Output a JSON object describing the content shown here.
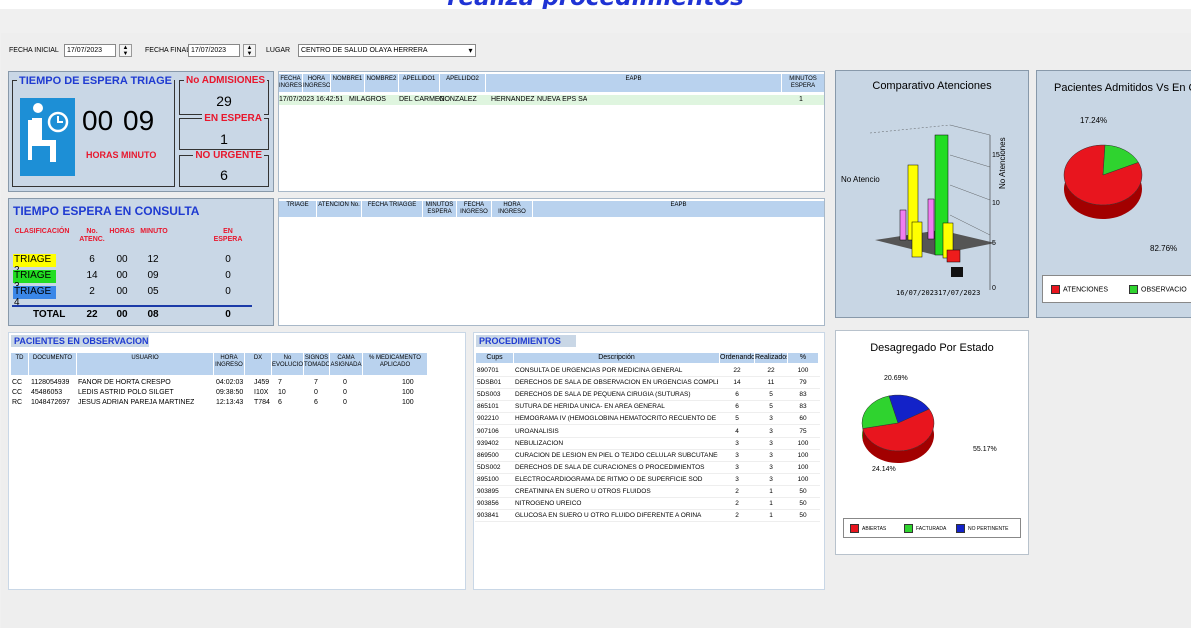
{
  "banner_title": "realiza procedimientos",
  "filters": {
    "fecha_inicial_label": "FECHA INICIAL",
    "fecha_inicial_value": "17/07/2023",
    "fecha_final_label": "FECHA FINAL",
    "fecha_final_value": "17/07/2023",
    "lugar_label": "LUGAR",
    "lugar_value": "CENTRO DE SALUD OLAYA HERRERA"
  },
  "triage_wait": {
    "title": "TIEMPO DE ESPERA TRIAGE",
    "hours": "00",
    "minutes": "09",
    "hours_label": "HORAS",
    "minutes_label": "MINUTO"
  },
  "counters": {
    "no_admisiones_label": "No ADMISIONES",
    "no_admisiones_value": "29",
    "en_espera_label": "EN ESPERA",
    "en_espera_value": "1",
    "no_urgente_label": "NO URGENTE",
    "no_urgente_value": "6"
  },
  "waiting_table": {
    "headers": [
      "FECHA INGRESO",
      "HORA INGRESO",
      "NOMBRE1",
      "NOMBRE2",
      "APELLIDO1",
      "APELLIDO2",
      "EAPB",
      "MINUTOS ESPERA"
    ],
    "rows": [
      [
        "17/07/2023",
        "16:42:51",
        "MILAGROS",
        "DEL CARMEN",
        "GONZALEZ",
        "HERNANDEZ",
        "NUEVA EPS SA",
        "1"
      ]
    ]
  },
  "consulta": {
    "title": "TIEMPO ESPERA EN CONSULTA",
    "headers": [
      "CLASIFICACIÓN",
      "No. ATENC.",
      "HORAS",
      "MINUTO",
      "EN ESPERA"
    ],
    "rows": [
      {
        "label": "TRIAGE 2",
        "color": "#ffff00",
        "atenc": "6",
        "horas": "00",
        "minuto": "12",
        "espera": "0"
      },
      {
        "label": "TRIAGE 3",
        "color": "#22dd22",
        "atenc": "14",
        "horas": "00",
        "minuto": "09",
        "espera": "0"
      },
      {
        "label": "TRIAGE 4",
        "color": "#3a87e8",
        "atenc": "2",
        "horas": "00",
        "minuto": "05",
        "espera": "0"
      }
    ],
    "total": {
      "label": "TOTAL",
      "atenc": "22",
      "horas": "00",
      "minuto": "08",
      "espera": "0"
    }
  },
  "triage_table": {
    "headers": [
      "TRIAGE",
      "ATENCIÓN No.",
      "FECHA TRIAGGE",
      "MINUTOS ESPERA",
      "FECHA INGRESO",
      "HORA INGRESO",
      "EAPB"
    ]
  },
  "observacion": {
    "title": "PACIENTES EN OBSERVACION",
    "headers": [
      "TD",
      "DOCUMENTO",
      "USUARIO",
      "HORA INGRESO",
      "DX",
      "No EVOLUCION",
      "SIGNOS TOMADOS",
      "CAMA ASIGNADA",
      "% MEDICAMENTO APLICADO"
    ],
    "rows": [
      [
        "CC",
        "1128054939",
        "FANOR DE HORTA CRESPO",
        "04:02:03",
        "J459",
        "7",
        "7",
        "0",
        "100"
      ],
      [
        "CC",
        "45486053",
        "LEDIS ASTRID POLO SILGET",
        "09:38:50",
        "I10X",
        "10",
        "0",
        "0",
        "100"
      ],
      [
        "RC",
        "1048472697",
        "JESUS ADRIAN PAREJA MARTINEZ",
        "12:13:43",
        "T784",
        "6",
        "6",
        "0",
        "100"
      ]
    ]
  },
  "procedimientos": {
    "title": "PROCEDIMIENTOS",
    "headers": [
      "Cups",
      "Descripción",
      "Ordenando",
      "Realizados",
      "%"
    ],
    "rows": [
      [
        "890701",
        "CONSULTA DE URGENCIAS POR MEDICINA GENERAL",
        "22",
        "22",
        "100"
      ],
      [
        "5DSB01",
        "DERECHOS DE SALA DE OBSERVACION EN URGENCIAS COMPLEJI",
        "14",
        "11",
        "79"
      ],
      [
        "5DS003",
        "DERECHOS DE SALA DE PEQUEÑA CIRUGIA (SUTURAS)",
        "6",
        "5",
        "83"
      ],
      [
        "865101",
        "SUTURA DE HERIDA UNICA- EN AREA GENERAL",
        "6",
        "5",
        "83"
      ],
      [
        "902210",
        "HEMOGRAMA IV (HEMOGLOBINA HEMATOCRITO RECUENTO DE ER",
        "5",
        "3",
        "60"
      ],
      [
        "907106",
        "UROANALISIS",
        "4",
        "3",
        "75"
      ],
      [
        "939402",
        "NEBULIZACION",
        "3",
        "3",
        "100"
      ],
      [
        "869500",
        "CURACION DE LESION EN PIEL O TEJIDO CELULAR SUBCUTANEO S",
        "3",
        "3",
        "100"
      ],
      [
        "5DS002",
        "DERECHOS DE SALA DE CURACIONES O PROCEDIMIENTOS",
        "3",
        "3",
        "100"
      ],
      [
        "895100",
        "ELECTROCARDIOGRAMA DE RITMO O DE SUPERFICIE SOD",
        "3",
        "3",
        "100"
      ],
      [
        "903895",
        "CREATININA EN SUERO U OTROS FLUIDOS",
        "2",
        "1",
        "50"
      ],
      [
        "903856",
        "NITROGENO UREICO",
        "2",
        "1",
        "50"
      ],
      [
        "903841",
        "GLUCOSA EN SUERO U OTRO FLUIDO DIFERENTE A ORINA",
        "2",
        "1",
        "50"
      ]
    ]
  },
  "comparativo": {
    "title": "Comparativo Atenciones",
    "left_label": "No Atencio",
    "axis_label": "No Atenciones",
    "ticks": [
      "0",
      "5",
      "10",
      "15"
    ],
    "x_label": "16/07/202317/07/2023"
  },
  "admitidos": {
    "title": "Pacientes Admitidos Vs En Observa",
    "legend": [
      "ATENCIONES",
      "OBSERVACIO"
    ],
    "pct_labels": [
      "17.24%",
      "82.76%"
    ]
  },
  "estado": {
    "title": "Desagregado Por Estado",
    "legend": [
      "ABIERTAS",
      "FACTURADA",
      "NO PERTINENTE"
    ],
    "pct_labels": [
      "20.69%",
      "24.14%",
      "55.17%"
    ]
  },
  "chart_data": [
    {
      "type": "bar",
      "title": "Comparativo Atenciones",
      "categories": [
        "16/07/2023",
        "17/07/2023"
      ],
      "ylabel": "No Atenciones",
      "ylim": [
        0,
        15
      ],
      "series": []
    },
    {
      "type": "pie",
      "title": "Pacientes Admitidos Vs En Observa",
      "categories": [
        "ATENCIONES",
        "OBSERVACIO"
      ],
      "values": [
        82.76,
        17.24
      ],
      "colors": [
        "#e8151e",
        "#2fd32f"
      ]
    },
    {
      "type": "pie",
      "title": "Desagregado Por Estado",
      "categories": [
        "ABIERTAS",
        "FACTURADA",
        "NO PERTINENTE"
      ],
      "values": [
        55.17,
        24.14,
        20.69
      ],
      "colors": [
        "#e8151e",
        "#2fd32f",
        "#1322c8"
      ]
    }
  ],
  "colors": {
    "accent_blue": "#1f3bd1",
    "alert_red": "#e8172d",
    "panel_bg": "#c9d7e6",
    "header_bg": "#b9d2ee"
  }
}
